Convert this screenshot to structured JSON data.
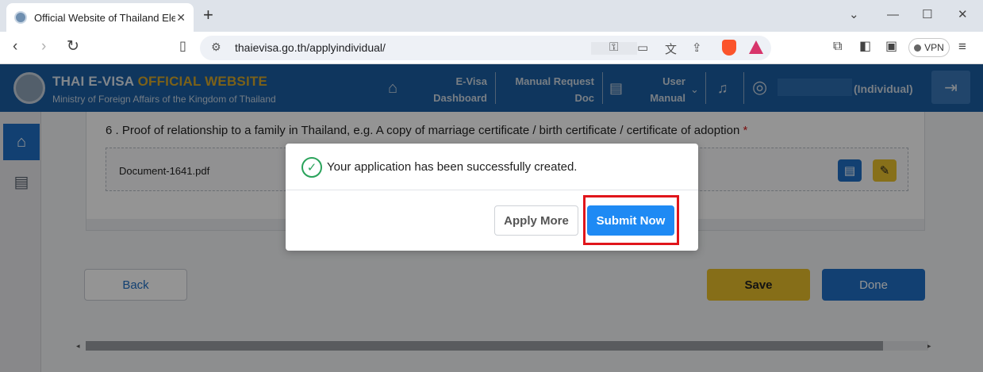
{
  "browser": {
    "tab_title": "Official Website of Thailand Ele",
    "url": "thaievisa.go.th/applyindividual/",
    "vpn_label": "VPN"
  },
  "header": {
    "title_main": "THAI E-VISA ",
    "title_accent": "OFFICIAL WEBSITE",
    "subtitle": "Ministry of Foreign Affairs of the Kingdom of Thailand",
    "nav": {
      "evisa_line1": "E-Visa",
      "evisa_line2": "Dashboard",
      "manual_request_line1": "Manual Request",
      "manual_request_line2": "Doc",
      "user_manual_line1": "User",
      "user_manual_line2": "Manual"
    },
    "account_type": "(Individual)"
  },
  "form": {
    "question_label": "6 . Proof of relationship to a family in Thailand, e.g. A copy of marriage certificate / birth certificate / certificate of adoption",
    "required_mark": "*",
    "document_name": "Document-1641.pdf",
    "back_label": "Back",
    "save_label": "Save",
    "done_label": "Done"
  },
  "modal": {
    "message": "Your application has been successfully created.",
    "apply_more_label": "Apply More",
    "submit_now_label": "Submit Now"
  },
  "colors": {
    "header_bg": "#1a5ea3",
    "accent_gold": "#d4a72c",
    "primary_blue": "#1f6fc4",
    "save_yellow": "#e7bd2a",
    "success_green": "#2aa35b",
    "highlight_red": "#e0151b"
  }
}
